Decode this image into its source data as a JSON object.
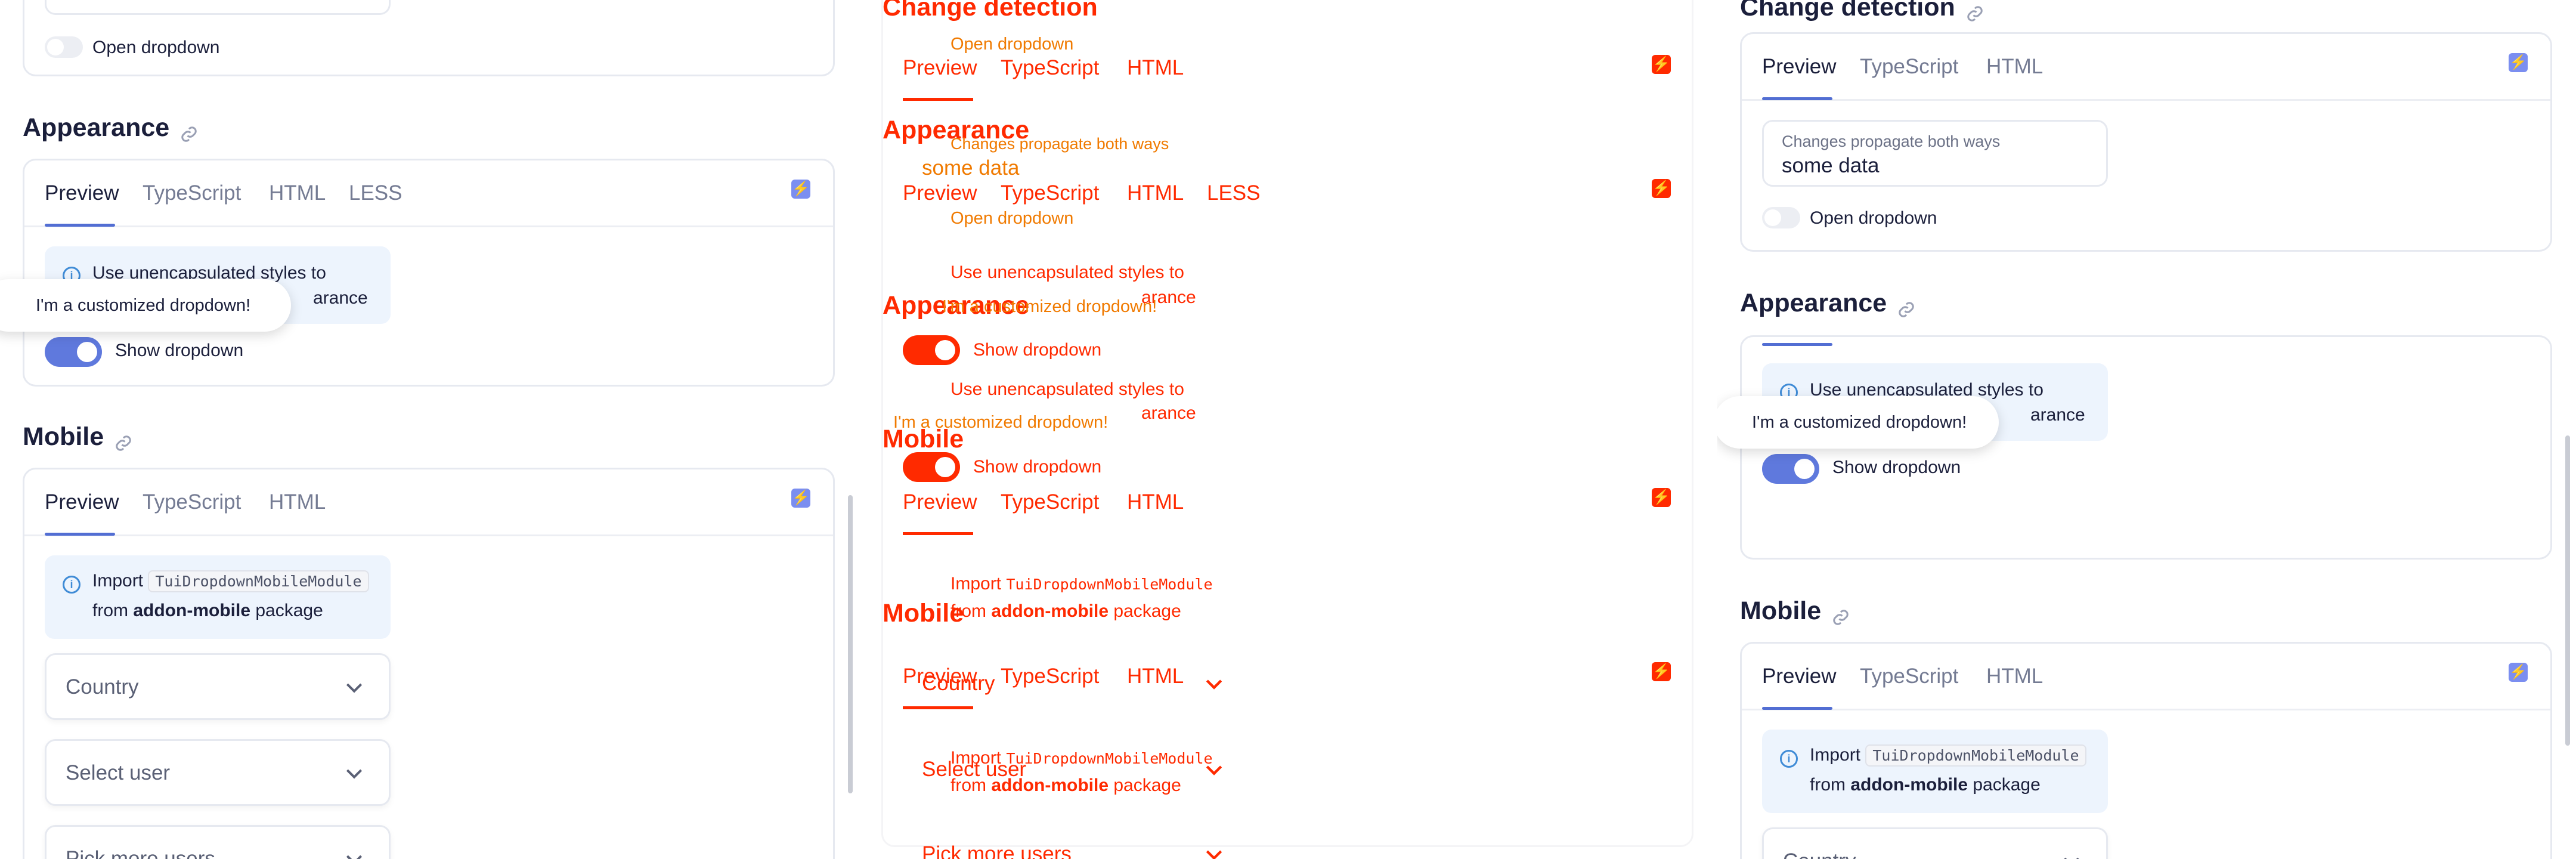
{
  "theme": {
    "accent": "#526ed3",
    "toggle_on": "#5f79dd",
    "info_bg": "#edf4fd",
    "diff_red": "#ff2a00",
    "diff_orange": "#f07a00"
  },
  "sections": {
    "change_detection": "Change detection",
    "appearance": "Appearance",
    "mobile": "Mobile"
  },
  "tabs": {
    "preview": "Preview",
    "typescript": "TypeScript",
    "html": "HTML",
    "less": "LESS"
  },
  "icons": {
    "link": "link-icon",
    "bolt": "stackblitz-bolt-icon",
    "info": "info-icon",
    "chevron": "chevron-down-icon"
  },
  "change_detection_demo": {
    "field_label": "Changes propagate both ways",
    "field_value": "some data",
    "toggle_label": "Open dropdown"
  },
  "appearance_demo": {
    "note_line1": "Use unencapsulated styles to",
    "note_line2_suffix": "arance",
    "toggle_label": "Show dropdown",
    "tooltip": "I'm a customized dropdown!"
  },
  "mobile_demo": {
    "note_import": "Import",
    "note_module": "TuiDropdownMobileModule",
    "note_from": "from",
    "note_package": "addon-mobile",
    "note_package_suffix": "package",
    "select_country": "Country",
    "select_user": "Select user",
    "select_more_users": "Pick more users"
  }
}
